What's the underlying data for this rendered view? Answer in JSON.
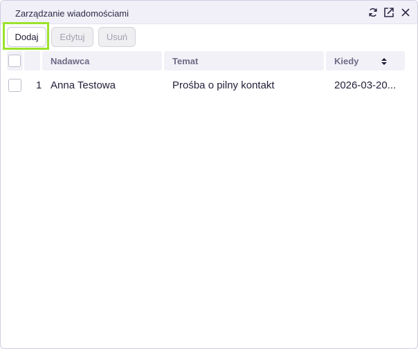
{
  "window": {
    "title": "Zarządzanie wiadomościami",
    "icons": [
      "refresh-icon",
      "popout-icon",
      "close-icon"
    ]
  },
  "toolbar": {
    "add_label": "Dodaj",
    "edit_label": "Edytuj",
    "delete_label": "Usuń"
  },
  "table": {
    "columns": [
      "Nadawca",
      "Temat",
      "Kiedy"
    ],
    "sort_column": "Kiedy",
    "rows": [
      {
        "index": "1",
        "sender": "Anna Testowa",
        "subject": "Prośba o pilny kontakt",
        "when": "2026-03-20..."
      }
    ]
  },
  "colors": {
    "accent_focus": "#9be22c",
    "titlebar_bg": "#f1f0f9",
    "header_bg": "#f2f1f8",
    "header_text": "#6d6a84"
  }
}
